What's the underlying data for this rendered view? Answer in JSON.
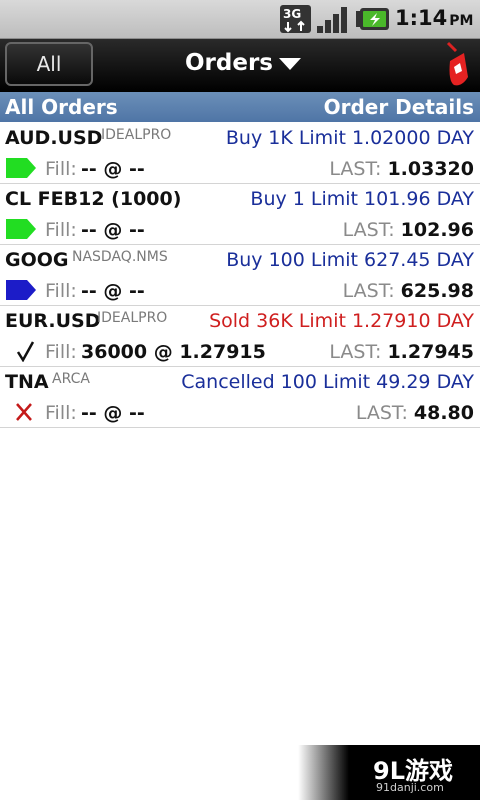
{
  "status_bar": {
    "network": "3G",
    "time": "1:14",
    "ampm": "PM"
  },
  "header": {
    "left_button": "All",
    "title": "Orders"
  },
  "columns": {
    "left": "All Orders",
    "right": "Order Details"
  },
  "orders": [
    {
      "symbol": "AUD.USD",
      "exchange": "IDEALPRO",
      "detail": "Buy 1K Limit 1.02000 DAY",
      "detail_color": "#1a2f9a",
      "status_icon": "green-tag-icon",
      "fill_label": "Fill:",
      "fill_value": "-- @ --",
      "last_label": "LAST:",
      "last_value": "1.03320"
    },
    {
      "symbol": "CL FEB12 (1000)",
      "exchange": "",
      "detail": "Buy 1 Limit 101.96 DAY",
      "detail_color": "#1a2f9a",
      "status_icon": "green-tag-icon",
      "fill_label": "Fill:",
      "fill_value": "-- @ --",
      "last_label": "LAST:",
      "last_value": "102.96"
    },
    {
      "symbol": "GOOG",
      "exchange": "NASDAQ.NMS",
      "detail": "Buy 100 Limit 627.45 DAY",
      "detail_color": "#1a2f9a",
      "status_icon": "blue-tag-icon",
      "fill_label": "Fill:",
      "fill_value": "-- @ --",
      "last_label": "LAST:",
      "last_value": "625.98"
    },
    {
      "symbol": "EUR.USD",
      "exchange": "IDEALPRO",
      "detail": "Sold 36K Limit 1.27910 DAY",
      "detail_color": "#cf1f1f",
      "status_icon": "checkmark-icon",
      "fill_label": "Fill:",
      "fill_value": "36000 @ 1.27915",
      "last_label": "LAST:",
      "last_value": "1.27945"
    },
    {
      "symbol": "TNA",
      "exchange": "ARCA",
      "detail": "Cancelled 100 Limit 49.29 DAY",
      "detail_color": "#1a2f9a",
      "status_icon": "cross-icon",
      "fill_label": "Fill:",
      "fill_value": "-- @ --",
      "last_label": "LAST:",
      "last_value": "48.80"
    }
  ],
  "watermark": {
    "brand": "9L游戏",
    "site": "91danji.com"
  }
}
